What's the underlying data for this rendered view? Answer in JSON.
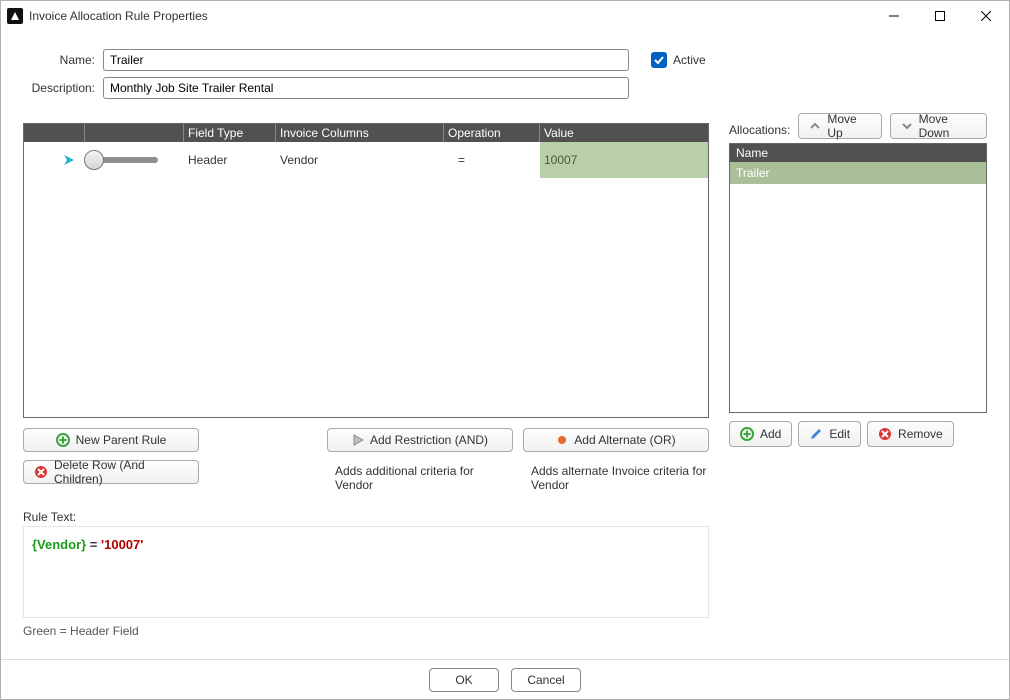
{
  "window": {
    "title": "Invoice Allocation Rule Properties"
  },
  "form": {
    "name_label": "Name:",
    "name_value": "Trailer",
    "desc_label": "Description:",
    "desc_value": "Monthly Job Site Trailer Rental",
    "active_label": "Active",
    "active_checked": true
  },
  "grid": {
    "headers": {
      "field_type": "Field Type",
      "invoice_columns": "Invoice Columns",
      "operation": "Operation",
      "value": "Value"
    },
    "rows": [
      {
        "field_type": "Header",
        "invoice_columns": "Vendor",
        "operation": "=",
        "value": "10007"
      }
    ]
  },
  "under": {
    "new_parent": "New Parent Rule",
    "delete_row": "Delete Row (And Children)",
    "add_restriction": "Add Restriction (AND)",
    "restriction_hint": "Adds additional criteria for Vendor",
    "add_alternate": "Add Alternate (OR)",
    "alternate_hint": "Adds alternate Invoice criteria for Vendor"
  },
  "rule_text": {
    "label": "Rule Text:",
    "field": "{Vendor}",
    "eq": " = ",
    "value": "'10007'",
    "legend": "Green   =  Header Field"
  },
  "allocations": {
    "label": "Allocations:",
    "move_up": "Move Up",
    "move_down": "Move Down",
    "header": "Name",
    "items": [
      {
        "name": "Trailer"
      }
    ],
    "add": "Add",
    "edit": "Edit",
    "remove": "Remove"
  },
  "footer": {
    "ok": "OK",
    "cancel": "Cancel"
  }
}
